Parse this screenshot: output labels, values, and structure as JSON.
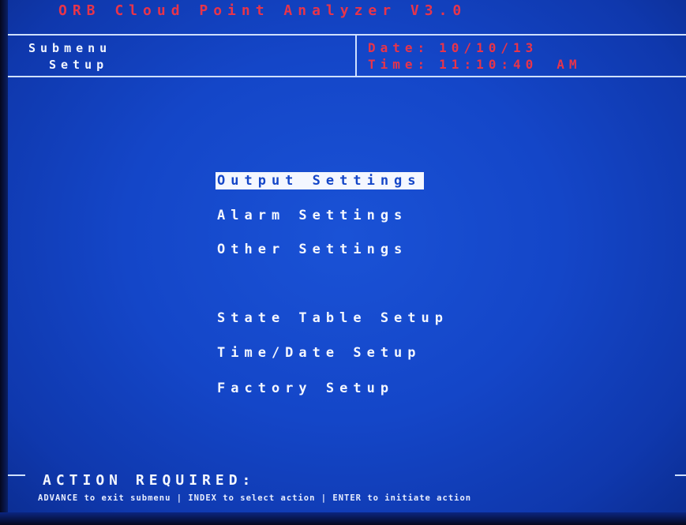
{
  "header": {
    "title": "ORB Cloud Point Analyzer V3.0"
  },
  "info": {
    "submenu_label": "Submenu",
    "submenu_name": "Setup",
    "date_label": "Date:",
    "date_value": "10/10/13",
    "time_label": "Time:",
    "time_value": "11:10:40",
    "time_ampm": "AM"
  },
  "menu": {
    "items": [
      {
        "label": "Output Settings",
        "selected": true
      },
      {
        "label": "Alarm Settings",
        "selected": false
      },
      {
        "label": "Other Settings",
        "selected": false
      },
      {
        "label": "State Table Setup",
        "selected": false
      },
      {
        "label": "Time/Date Setup",
        "selected": false
      },
      {
        "label": "Factory Setup",
        "selected": false
      }
    ]
  },
  "footer": {
    "action_title": "ACTION REQUIRED:",
    "hint": "ADVANCE to exit submenu | INDEX to select action | ENTER to initiate action"
  },
  "colors": {
    "background": "#1446c8",
    "title_text": "#e8344a",
    "menu_text": "#f4f7ff",
    "highlight_bg": "#f4f7ff"
  }
}
